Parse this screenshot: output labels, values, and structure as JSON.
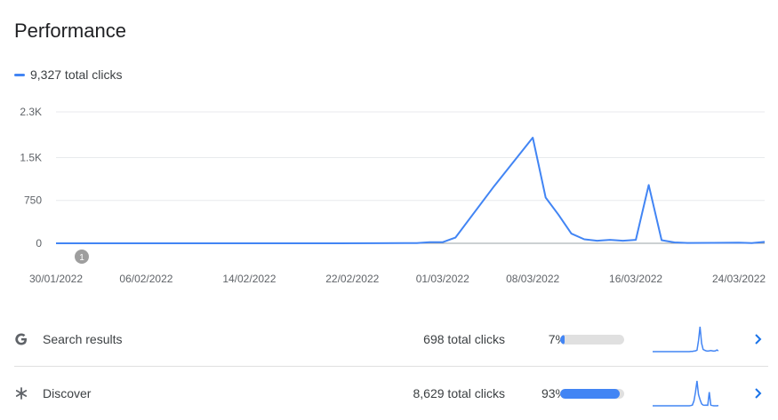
{
  "page": {
    "title": "Performance"
  },
  "legend": {
    "label": "9,327 total clicks",
    "color": "#4285f4"
  },
  "chart_data": {
    "type": "line",
    "y_ticks": [
      "2.3K",
      "1.5K",
      "750",
      "0"
    ],
    "ylim": [
      0,
      2300
    ],
    "xlim": [
      "2022-01-30",
      "2022-03-26"
    ],
    "x_tick_labels": [
      "30/01/2022",
      "06/02/2022",
      "14/02/2022",
      "22/02/2022",
      "01/03/2022",
      "08/03/2022",
      "16/03/2022",
      "24/03/2022"
    ],
    "x_tick_dates": [
      "2022-01-30",
      "2022-02-06",
      "2022-02-14",
      "2022-02-22",
      "2022-03-01",
      "2022-03-08",
      "2022-03-16",
      "2022-03-24"
    ],
    "annotation": {
      "label": "1",
      "date": "2022-02-01"
    },
    "series": [
      {
        "color": "#4285f4",
        "points": [
          [
            "2022-01-30",
            0
          ],
          [
            "2022-02-05",
            0
          ],
          [
            "2022-02-12",
            0
          ],
          [
            "2022-02-19",
            0
          ],
          [
            "2022-02-24",
            2
          ],
          [
            "2022-02-26",
            5
          ],
          [
            "2022-02-27",
            3
          ],
          [
            "2022-02-28",
            20
          ],
          [
            "2022-03-01",
            18
          ],
          [
            "2022-03-02",
            100
          ],
          [
            "2022-03-05",
            1000
          ],
          [
            "2022-03-08",
            1850
          ],
          [
            "2022-03-09",
            800
          ],
          [
            "2022-03-10",
            500
          ],
          [
            "2022-03-11",
            170
          ],
          [
            "2022-03-12",
            70
          ],
          [
            "2022-03-13",
            45
          ],
          [
            "2022-03-14",
            60
          ],
          [
            "2022-03-15",
            45
          ],
          [
            "2022-03-16",
            60
          ],
          [
            "2022-03-17",
            1020
          ],
          [
            "2022-03-18",
            55
          ],
          [
            "2022-03-19",
            15
          ],
          [
            "2022-03-20",
            6
          ],
          [
            "2022-03-22",
            8
          ],
          [
            "2022-03-23",
            10
          ],
          [
            "2022-03-24",
            12
          ],
          [
            "2022-03-25",
            5
          ],
          [
            "2022-03-26",
            25
          ]
        ]
      }
    ]
  },
  "rows": [
    {
      "icon": "google-g-icon",
      "name": "Search results",
      "clicks": "698 total clicks",
      "pct_label": "7%",
      "pct": 7,
      "spark": [
        0,
        0,
        0,
        0,
        0,
        0,
        0,
        0,
        0,
        0,
        0,
        0,
        0,
        0,
        0,
        0,
        0,
        0,
        0,
        0,
        0,
        0,
        0,
        0,
        0,
        1,
        1,
        2,
        3,
        5,
        40,
        90,
        30,
        8,
        5,
        3,
        2,
        3,
        4,
        3,
        2,
        3,
        6,
        3
      ]
    },
    {
      "icon": "discover-asterisk-icon",
      "name": "Discover",
      "clicks": "8,629 total clicks",
      "pct_label": "93%",
      "pct": 93,
      "spark": [
        0,
        0,
        0,
        0,
        0,
        0,
        0,
        0,
        0,
        0,
        0,
        0,
        0,
        0,
        0,
        0,
        0,
        0,
        0,
        0,
        0,
        0,
        0,
        0,
        0,
        1,
        3,
        20,
        55,
        100,
        45,
        25,
        8,
        3,
        2,
        3,
        2,
        55,
        3,
        1,
        0,
        0,
        0,
        1
      ]
    }
  ],
  "colors": {
    "accent": "#4285f4",
    "track": "#e0e0e0",
    "grid": "#e8eaed",
    "axis_text": "#5f6368"
  }
}
